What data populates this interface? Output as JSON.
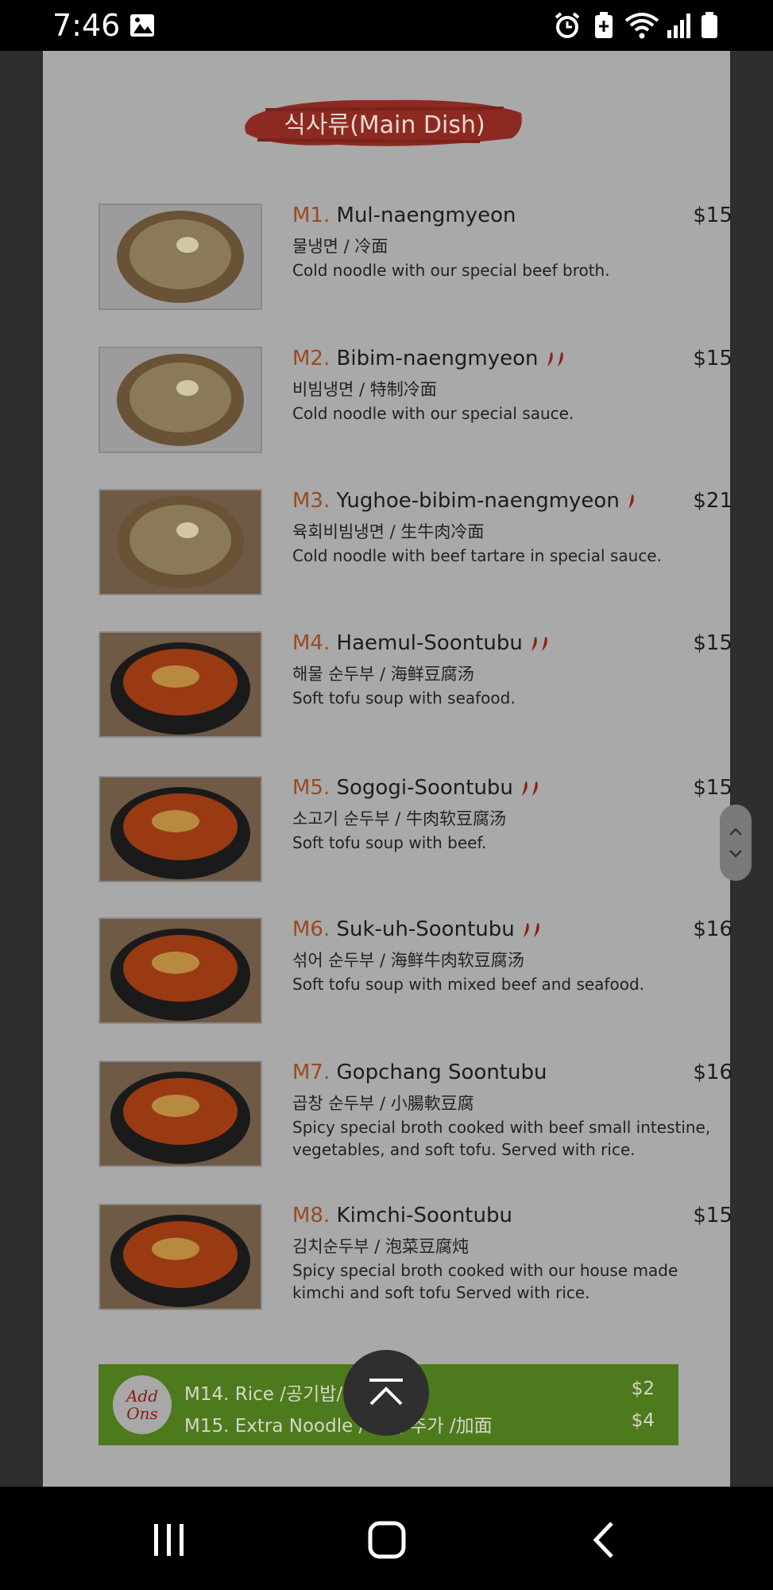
{
  "status_bar": {
    "time": "7:46",
    "icons": [
      "image-icon",
      "alarm-icon",
      "battery-saver-icon",
      "wifi-icon",
      "signal-icon",
      "battery-icon"
    ]
  },
  "menu": {
    "section_title": "식사류(Main Dish)",
    "items": [
      {
        "code": "M1.",
        "name": "Mul-naengmyeon",
        "chili": 0,
        "price": "$15",
        "sub": "물냉면 / 冷面",
        "desc": [
          "Cold noodle with our special beef broth."
        ]
      },
      {
        "code": "M2.",
        "name": "Bibim-naengmyeon",
        "chili": 2,
        "price": "$15",
        "sub": "비빔냉면 / 特制冷面",
        "desc": [
          "Cold noodle with our special sauce."
        ]
      },
      {
        "code": "M3.",
        "name": "Yughoe-bibim-naengmyeon",
        "chili": 1,
        "price": "$21",
        "sub": "육회비빔냉면 / 生牛肉冷面",
        "desc": [
          "Cold noodle with beef tartare in special sauce."
        ]
      },
      {
        "code": "M4.",
        "name": "Haemul-Soontubu",
        "chili": 2,
        "price": "$15",
        "sub": "해물 순두부 / 海鲜豆腐汤",
        "desc": [
          "Soft tofu soup with seafood."
        ]
      },
      {
        "code": "M5.",
        "name": "Sogogi-Soontubu",
        "chili": 2,
        "price": "$15",
        "sub": "소고기 순두부 / 牛肉软豆腐汤",
        "desc": [
          "Soft tofu soup with beef."
        ]
      },
      {
        "code": "M6.",
        "name": "Suk-uh-Soontubu",
        "chili": 2,
        "price": "$16",
        "sub": "섞어 순두부 / 海鲜牛肉软豆腐汤",
        "desc": [
          "Soft tofu soup with mixed beef and seafood."
        ]
      },
      {
        "code": "M7.",
        "name": "Gopchang Soontubu",
        "chili": 0,
        "price": "$16",
        "sub": "곱창 순두부 / 小腸軟豆腐",
        "desc": [
          "Spicy special broth cooked with beef small intestine,",
          "vegetables, and soft tofu. Served with rice."
        ]
      },
      {
        "code": "M8.",
        "name": "Kimchi-Soontubu",
        "chili": 0,
        "price": "$15",
        "sub": "김치순두부 / 泡菜豆腐炖",
        "desc": [
          "Spicy special broth cooked with our house made",
          "kimchi and soft tofu Served with rice."
        ]
      }
    ],
    "addons": {
      "badge_line1": "Add",
      "badge_line2": "Ons",
      "rows": [
        {
          "label": "M14. Rice /공기밥/",
          "price": "$2"
        },
        {
          "label": "M15. Extra Noodle / 사리 추가 /加面",
          "price": "$4"
        }
      ]
    }
  },
  "colors": {
    "accent_code": "#9a4a22",
    "brush_red": "#b3261e",
    "addons_green": "#4e7a1e"
  }
}
